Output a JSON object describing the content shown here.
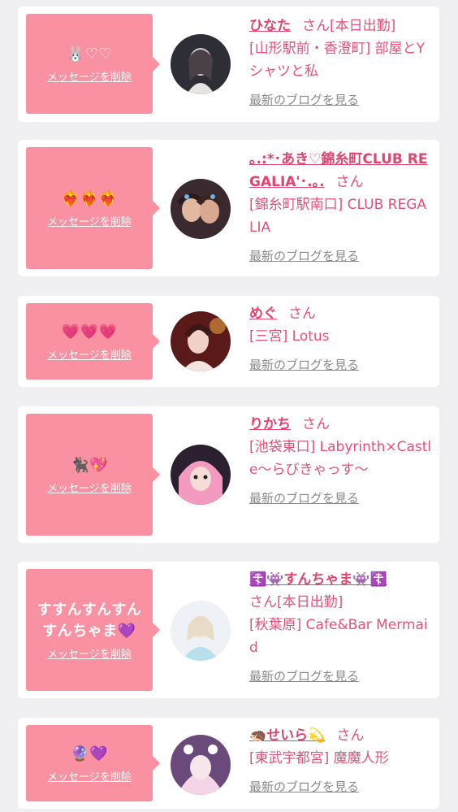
{
  "delete_label": "メッセージを削除",
  "blog_label": "最新のブログを見る",
  "san": "さん",
  "cards": [
    {
      "message": "🐰♡♡",
      "name": "ひなた",
      "status": "[本日出勤]",
      "area": "[山形駅前・香澄町]",
      "shop": "部屋とYシャツと私",
      "avatar_tone": [
        "#c9c6c8",
        "#3a3a44"
      ]
    },
    {
      "message": "❤️‍🔥❤️‍🔥❤️‍🔥",
      "name": "｡.:*･あき♡錦糸町CLUB REGALIA'･.｡.",
      "status": "",
      "area": "[錦糸町駅南口]",
      "shop": "CLUB REGALIA",
      "avatar_tone": [
        "#d8a58a",
        "#5a3a32"
      ]
    },
    {
      "message": "💗💗💗",
      "name": "めぐ",
      "status": "",
      "area": "[三宮]",
      "shop": "Lotus",
      "avatar_tone": [
        "#e8b8b0",
        "#6a2a2a"
      ]
    },
    {
      "message": "🐈‍⬛💖",
      "name": "りかち",
      "status": "",
      "area": "[池袋東口]",
      "shop": "Labyrinth×Castle〜らびきゃっす〜",
      "avatar_tone": [
        "#f0a0c0",
        "#3a3040"
      ]
    },
    {
      "message": "すすんすんすんすんちゃま💜",
      "name": "☦️👾すんちゃま👾☦️",
      "status": "[本日出勤]",
      "area": "[秋葉原]",
      "shop": "Cafe&Bar Mermaid",
      "avatar_tone": [
        "#f4f4f8",
        "#a8d4e4"
      ]
    },
    {
      "message": "🔮💜",
      "name": "🦔せいら💫",
      "status": "",
      "area": "[東武宇都宮]",
      "shop": "魔魔人形",
      "avatar_tone": [
        "#f2d8e8",
        "#7a5a8a"
      ]
    }
  ]
}
